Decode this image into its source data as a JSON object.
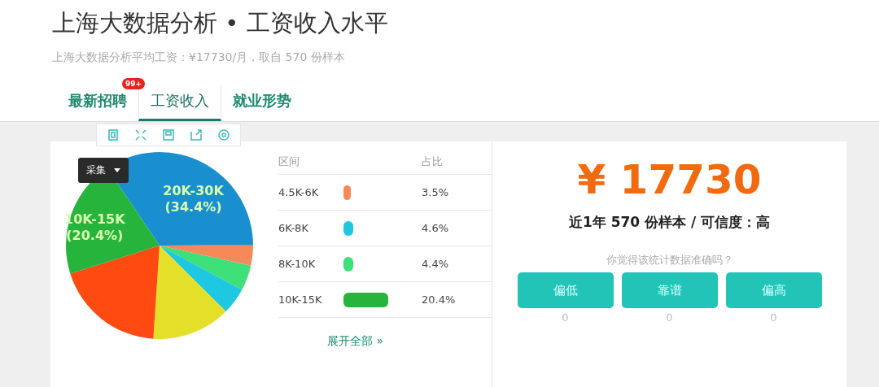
{
  "title": "上海大数据分析 • 工资收入水平",
  "subtitle": "上海大数据分析平均工资：¥17730/月，取自 570 份样本",
  "tabs": [
    {
      "label": "最新招聘",
      "selected": false,
      "badge": "99+"
    },
    {
      "label": "工资收入",
      "selected": true
    },
    {
      "label": "就业形势",
      "selected": false
    }
  ],
  "chart_tooltip": {
    "label": "采集"
  },
  "pie": {
    "chart_data": {
      "type": "pie",
      "series": [
        {
          "values": [
            34.4,
            3.5,
            4.4,
            4.6,
            13.6,
            19.1,
            20.4
          ]
        }
      ],
      "colors": [
        "#1a8fcf",
        "#f5895a",
        "#3ee07a",
        "#1ec8e0",
        "#e4e02a",
        "#ff4a12",
        "#27b43c"
      ],
      "value_labels": [
        "20K-30K\n(34.4%)",
        null,
        null,
        null,
        null,
        null,
        "10K-15K\n(20.4%)"
      ]
    }
  },
  "table": {
    "columns": [
      "区间",
      "占比"
    ],
    "rows": [
      {
        "range": "4.5K-6K",
        "color": "#f5895a",
        "share": "3.5%"
      },
      {
        "range": "6K-8K",
        "color": "#1ec8e0",
        "share": "4.6%"
      },
      {
        "range": "8K-10K",
        "color": "#3ee07a",
        "share": "4.4%"
      },
      {
        "range": "10K-15K",
        "color": "#27b43c",
        "share": "20.4%"
      }
    ],
    "expand_link": "展开全部 »"
  },
  "summary": {
    "salary": "¥ 17730",
    "samples": "近1年 570 份样本 / 可信度：高",
    "question": "你觉得该统计数据准确吗？",
    "votes": [
      {
        "label": "偏低",
        "count": "0"
      },
      {
        "label": "靠谱",
        "count": "0"
      },
      {
        "label": "偏高",
        "count": "0"
      }
    ]
  }
}
